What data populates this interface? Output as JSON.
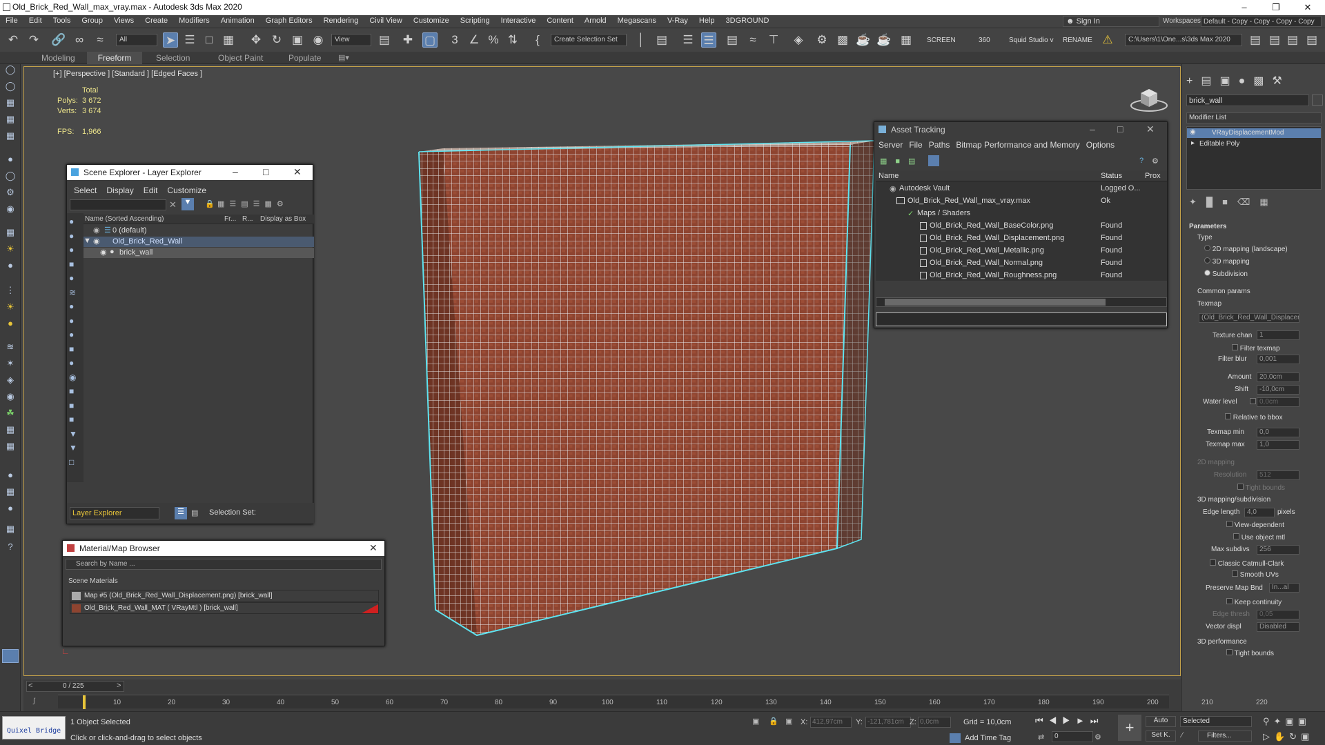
{
  "app": {
    "title": "Old_Brick_Red_Wall_max_vray.max - Autodesk 3ds Max 2020"
  },
  "menu": [
    "File",
    "Edit",
    "Tools",
    "Group",
    "Views",
    "Create",
    "Modifiers",
    "Animation",
    "Graph Editors",
    "Rendering",
    "Civil View",
    "Customize",
    "Scripting",
    "Interactive",
    "Content",
    "Arnold",
    "Megascans",
    "V-Ray",
    "Help",
    "3DGROUND"
  ],
  "signin": "Sign In",
  "workspaces_label": "Workspaces:",
  "workspaces_value": "Default - Copy - Copy - Copy - Copy",
  "toolbar": {
    "filter": "All",
    "view": "View",
    "selection_set": "Create Selection Set",
    "screen": "SCREEN",
    "n360": "360",
    "squid": "Squid Studio v",
    "rename": "RENAME",
    "path": "C:\\Users\\1\\One...s\\3ds Max 2020"
  },
  "ribbon": {
    "tabs": [
      "Modeling",
      "Freeform",
      "Selection",
      "Object Paint",
      "Populate"
    ]
  },
  "viewport": {
    "label": "[+] [Perspective ] [Standard ] [Edged Faces ]",
    "total": "Total",
    "polys_label": "Polys:",
    "polys": "3 672",
    "verts_label": "Verts:",
    "verts": "3 674",
    "fps_label": "FPS:",
    "fps": "1,966"
  },
  "scene_explorer": {
    "title": "Scene Explorer - Layer Explorer",
    "menu": [
      "Select",
      "Display",
      "Edit",
      "Customize"
    ],
    "col_name": "Name (Sorted Ascending)",
    "col_fr": "Fr...",
    "col_r": "R...",
    "col_box": "Display as Box",
    "rows": [
      "0 (default)",
      "Old_Brick_Red_Wall",
      "brick_wall"
    ],
    "footer_dd": "Layer Explorer",
    "selection_set": "Selection Set:"
  },
  "material_browser": {
    "title": "Material/Map Browser",
    "search": "Search by Name ...",
    "group": "Scene Materials",
    "items": [
      "Map #5 (Old_Brick_Red_Wall_Displacement.png)  [brick_wall]",
      "Old_Brick_Red_Wall_MAT  ( VRayMtl )  [brick_wall]"
    ]
  },
  "asset_tracking": {
    "title": "Asset Tracking",
    "menu": [
      "Server",
      "File",
      "Paths",
      "Bitmap Performance and Memory",
      "Options"
    ],
    "col_name": "Name",
    "col_status": "Status",
    "col_proxy": "Prox",
    "rows": [
      {
        "name": "Autodesk Vault",
        "status": "Logged O..."
      },
      {
        "name": "Old_Brick_Red_Wall_max_vray.max",
        "status": "Ok"
      },
      {
        "name": "Maps / Shaders",
        "status": ""
      },
      {
        "name": "Old_Brick_Red_Wall_BaseColor.png",
        "status": "Found"
      },
      {
        "name": "Old_Brick_Red_Wall_Displacement.png",
        "status": "Found"
      },
      {
        "name": "Old_Brick_Red_Wall_Metallic.png",
        "status": "Found"
      },
      {
        "name": "Old_Brick_Red_Wall_Normal.png",
        "status": "Found"
      },
      {
        "name": "Old_Brick_Red_Wall_Roughness.png",
        "status": "Found"
      }
    ]
  },
  "command_panel": {
    "object_name": "brick_wall",
    "modifier_list": "Modifier List",
    "stack": [
      "VRayDisplacementMod",
      "Editable Poly"
    ],
    "params_title": "Parameters",
    "type_label": "Type",
    "types": [
      "2D mapping (landscape)",
      "3D mapping",
      "Subdivision"
    ],
    "common": "Common params",
    "texmap_label": "Texmap",
    "texmap_value": "(Old_Brick_Red_Wall_Displacem",
    "texture_chan_label": "Texture chan",
    "texture_chan": "1",
    "filter_texmap": "Filter texmap",
    "filter_blur_label": "Filter blur",
    "filter_blur": "0,001",
    "amount_label": "Amount",
    "amount": "20,0cm",
    "shift_label": "Shift",
    "shift": "-10,0cm",
    "water_label": "Water level",
    "water": "0,0cm",
    "relative_bbox": "Relative to bbox",
    "texmap_min_label": "Texmap min",
    "texmap_min": "0,0",
    "texmap_max_label": "Texmap max",
    "texmap_max": "1,0",
    "map2d": "2D mapping",
    "resolution_label": "Resolution",
    "resolution": "512",
    "tight_bounds": "Tight bounds",
    "map3d": "3D mapping/subdivision",
    "edge_length_label": "Edge length",
    "edge_length": "4,0",
    "pixels": "pixels",
    "view_dependent": "View-dependent",
    "use_object_mtl": "Use object mtl",
    "max_subdivs_label": "Max subdivs",
    "max_subdivs": "256",
    "catmull": "Classic Catmull-Clark",
    "smooth_uvs": "Smooth UVs",
    "preserve_label": "Preserve Map Bnd",
    "preserve": "In...al",
    "keep_cont": "Keep continuity",
    "edge_thresh_label": "Edge thresh",
    "edge_thresh": "0,05",
    "vector_label": "Vector displ",
    "vector": "Disabled",
    "perf": "3D performance",
    "tight_bounds2": "Tight bounds"
  },
  "timeline": {
    "frame": "0 / 225",
    "ticks": [
      "10",
      "20",
      "30",
      "40",
      "50",
      "60",
      "70",
      "80",
      "90",
      "100",
      "110",
      "120",
      "130",
      "140",
      "150",
      "160",
      "170",
      "180",
      "190",
      "200",
      "210",
      "220"
    ]
  },
  "status": {
    "quixel": "Quixel Bridge",
    "selected": "1 Object Selected",
    "hint": "Click or click-and-drag to select objects",
    "x_label": "X:",
    "x": "412,97cm",
    "y_label": "Y:",
    "y": "-121,781cm",
    "z_label": "Z:",
    "z": "0,0cm",
    "grid": "Grid = 10,0cm",
    "add_time_tag": "Add Time Tag",
    "auto": "Auto",
    "selected_dd": "Selected",
    "setk": "Set K.",
    "filters": "Filters...",
    "frame_field": "0"
  },
  "colors": {
    "accent": "#5b7fae",
    "viewport_border": "#c4a24a",
    "wall_edge": "#5de3f0",
    "brick": "#9a4a2e"
  }
}
